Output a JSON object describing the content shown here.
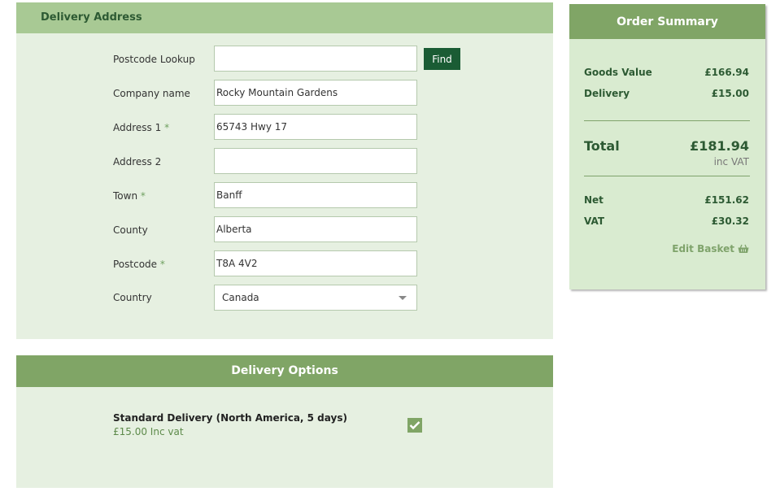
{
  "delivery_address": {
    "title": "Delivery Address",
    "postcode_lookup": {
      "label": "Postcode Lookup",
      "value": ""
    },
    "find_button": "Find",
    "company": {
      "label": "Company name",
      "value": "Rocky Mountain Gardens"
    },
    "address1": {
      "label": "Address 1",
      "required": "*",
      "value": "65743 Hwy 17"
    },
    "address2": {
      "label": "Address 2",
      "value": ""
    },
    "town": {
      "label": "Town",
      "required": "*",
      "value": "Banff"
    },
    "county": {
      "label": "County",
      "value": "Alberta"
    },
    "postcode": {
      "label": "Postcode",
      "required": "*",
      "value": "T8A 4V2"
    },
    "country": {
      "label": "Country",
      "value": "Canada"
    }
  },
  "delivery_options": {
    "title": "Delivery Options",
    "option": {
      "name": "Standard Delivery (North America, 5 days)",
      "price": "£15.00 Inc vat",
      "checked": true
    }
  },
  "order_summary": {
    "title": "Order Summary",
    "goods_value": {
      "label": "Goods Value",
      "value": "£166.94"
    },
    "delivery": {
      "label": "Delivery",
      "value": "£15.00"
    },
    "total": {
      "label": "Total",
      "value": "£181.94",
      "note": "inc VAT"
    },
    "net": {
      "label": "Net",
      "value": "£151.62"
    },
    "vat": {
      "label": "VAT",
      "value": "£30.32"
    },
    "edit_basket": "Edit Basket",
    "edit_basket_icon": "basket-icon"
  },
  "colors": {
    "accent_dark": "#1a5c34",
    "header_green": "#80a566",
    "header_light_green": "#a8c994",
    "panel_bg": "#e6f0e1",
    "summary_bg": "#d9ebd0"
  }
}
